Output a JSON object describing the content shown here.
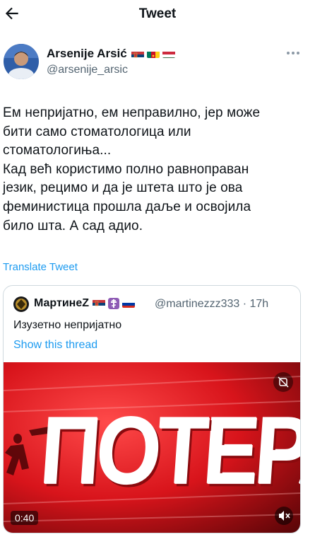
{
  "header": {
    "title": "Tweet",
    "back_icon": "back-arrow-icon"
  },
  "author": {
    "name": "Arsenije Arsić",
    "handle": "@arsenije_arsic",
    "flags": [
      "serbia-flag",
      "cameroon-flag",
      "hungary-flag"
    ]
  },
  "tweet": {
    "text": "Ем непријатно, ем неправилно, јер може\nбити само стоматологица или\nстоматологиња...\nКад већ користимо полно равноправан\nјезик, рецимо и да је штета што је ова\nфеминистица прошла даље и освојила\nбило шта. А сад адио.",
    "translate_label": "Translate Tweet"
  },
  "quote": {
    "name": "МартинеZ",
    "flags": [
      "serbia-flag",
      "orthodox-cross-icon",
      "russia-flag"
    ],
    "handle": "@martinezzz333 · 17h",
    "text": "Изузетно непријатно",
    "show_thread": "Show this thread",
    "video": {
      "duration": "0:40",
      "overlay_text": "ПОТЕРА",
      "badge_icon": "content-warning-icon",
      "mute_icon": "muted-speaker-icon"
    }
  },
  "colors": {
    "link": "#1d9bf0",
    "secondary": "#536471",
    "border": "#cfd9de",
    "video_red": "#d8141b"
  }
}
